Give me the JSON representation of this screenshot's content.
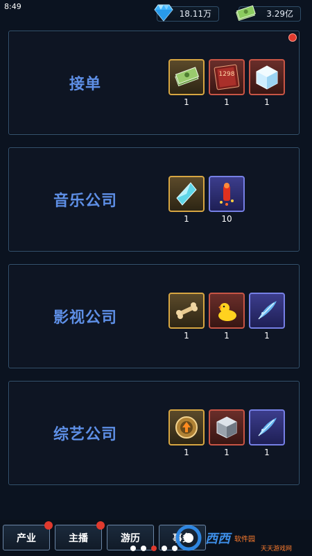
{
  "status": {
    "time": "8:49"
  },
  "currencies": {
    "diamond": {
      "icon": "diamond-icon",
      "value": "18.11万"
    },
    "cash": {
      "icon": "cash-stack-icon",
      "value": "3.29亿"
    }
  },
  "panels": [
    {
      "title": "接单",
      "has_badge": true,
      "rewards": [
        {
          "icon": "cash-stack-icon",
          "frame": "gold",
          "count": "1"
        },
        {
          "icon": "ticket-card-icon",
          "frame": "red",
          "count": "1",
          "label": "1298"
        },
        {
          "icon": "ice-cube-icon",
          "frame": "red",
          "count": "1"
        }
      ]
    },
    {
      "title": "音乐公司",
      "has_badge": false,
      "rewards": [
        {
          "icon": "crystal-icon",
          "frame": "gold",
          "count": "1"
        },
        {
          "icon": "firework-icon",
          "frame": "blue",
          "count": "10"
        }
      ]
    },
    {
      "title": "影视公司",
      "has_badge": false,
      "rewards": [
        {
          "icon": "bone-icon",
          "frame": "gold",
          "count": "1"
        },
        {
          "icon": "rubber-duck-icon",
          "frame": "red",
          "count": "1"
        },
        {
          "icon": "blue-feather-icon",
          "frame": "blue",
          "count": "1"
        }
      ]
    },
    {
      "title": "综艺公司",
      "has_badge": false,
      "rewards": [
        {
          "icon": "upgrade-badge-icon",
          "frame": "gold",
          "count": "1"
        },
        {
          "icon": "silver-cube-icon",
          "frame": "red",
          "count": "1"
        },
        {
          "icon": "blue-feather-icon",
          "frame": "blue",
          "count": "1"
        }
      ]
    }
  ],
  "tabs": [
    {
      "label": "产业",
      "has_badge": true
    },
    {
      "label": "主播",
      "has_badge": true
    },
    {
      "label": "游历",
      "has_badge": false
    },
    {
      "label": "事务",
      "has_badge": false
    }
  ],
  "page_dots": {
    "count": 5,
    "active_index": 2
  },
  "watermark": {
    "text": "西西",
    "text2": "软件园",
    "corner_text": "天天游戏网"
  }
}
